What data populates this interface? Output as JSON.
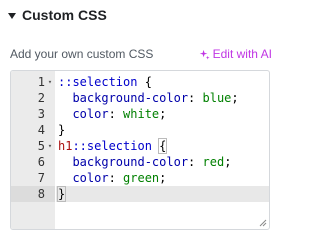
{
  "section": {
    "title": "Custom CSS"
  },
  "field": {
    "label": "Add your own custom CSS",
    "ai_label": "Edit with AI"
  },
  "editor": {
    "lines": [
      {
        "num": "1",
        "fold": "▾",
        "parts": [
          {
            "t": "::selection",
            "c": "sel"
          },
          {
            "t": " {",
            "c": ""
          }
        ]
      },
      {
        "num": "2",
        "fold": "",
        "parts": [
          {
            "t": "  ",
            "c": ""
          },
          {
            "t": "background-color",
            "c": "prop"
          },
          {
            "t": ": ",
            "c": ""
          },
          {
            "t": "blue",
            "c": "val"
          },
          {
            "t": ";",
            "c": ""
          }
        ]
      },
      {
        "num": "3",
        "fold": "",
        "parts": [
          {
            "t": "  ",
            "c": ""
          },
          {
            "t": "color",
            "c": "prop"
          },
          {
            "t": ": ",
            "c": ""
          },
          {
            "t": "white",
            "c": "val"
          },
          {
            "t": ";",
            "c": ""
          }
        ]
      },
      {
        "num": "4",
        "fold": "",
        "parts": [
          {
            "t": "}",
            "c": ""
          }
        ]
      },
      {
        "num": "5",
        "fold": "▾",
        "parts": [
          {
            "t": "h1",
            "c": "tag"
          },
          {
            "t": "::selection",
            "c": "sel"
          },
          {
            "t": " ",
            "c": ""
          },
          {
            "t": "{",
            "c": "bracket-hi"
          }
        ]
      },
      {
        "num": "6",
        "fold": "",
        "parts": [
          {
            "t": "  ",
            "c": ""
          },
          {
            "t": "background-color",
            "c": "prop"
          },
          {
            "t": ": ",
            "c": ""
          },
          {
            "t": "red",
            "c": "val"
          },
          {
            "t": ";",
            "c": ""
          }
        ]
      },
      {
        "num": "7",
        "fold": "",
        "parts": [
          {
            "t": "  ",
            "c": ""
          },
          {
            "t": "color",
            "c": "prop"
          },
          {
            "t": ": ",
            "c": ""
          },
          {
            "t": "green",
            "c": "val"
          },
          {
            "t": ";",
            "c": ""
          }
        ]
      },
      {
        "num": "8",
        "fold": "",
        "active": true,
        "cursor": true,
        "parts": [
          {
            "t": "}",
            "c": "bracket-hi"
          }
        ]
      }
    ]
  },
  "colors": {
    "accent_ai": "#c036e4",
    "heading": "#1f2124",
    "label": "#515962",
    "gutter": "#ebebeb"
  },
  "icons": {
    "section_toggle": "caret-down-icon",
    "ai": "sparkle-icon",
    "resize": "resize-handle-icon"
  }
}
